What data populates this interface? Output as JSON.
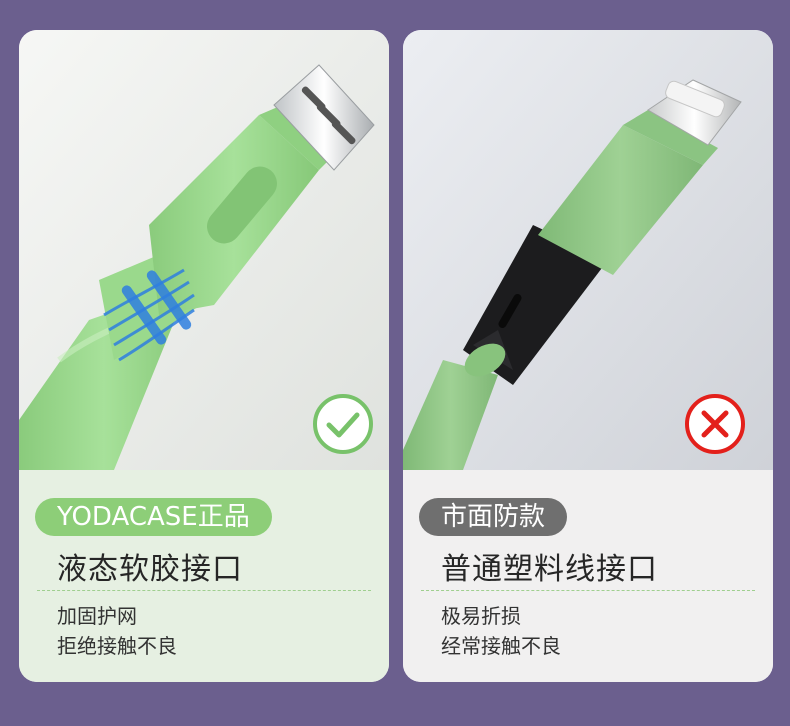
{
  "left_card": {
    "badge": "YODACASE正品",
    "title": "液态软胶接口",
    "features": [
      "加固护网",
      "拒绝接触不良"
    ],
    "status_icon": "check-circle-icon",
    "accent_color": "#8dce78"
  },
  "right_card": {
    "badge": "市面防款",
    "title": "普通塑料线接口",
    "features": [
      "极易折损",
      "经常接触不良"
    ],
    "status_icon": "cross-circle-icon",
    "accent_color": "#e3201b"
  },
  "colors": {
    "background": "#6b5f8e",
    "left_info_bg": "#e6f0e2",
    "right_info_bg": "#f1f0f0",
    "cable_green": "#9cd98f",
    "check_green": "#78c26a",
    "cross_red": "#e3201b"
  }
}
